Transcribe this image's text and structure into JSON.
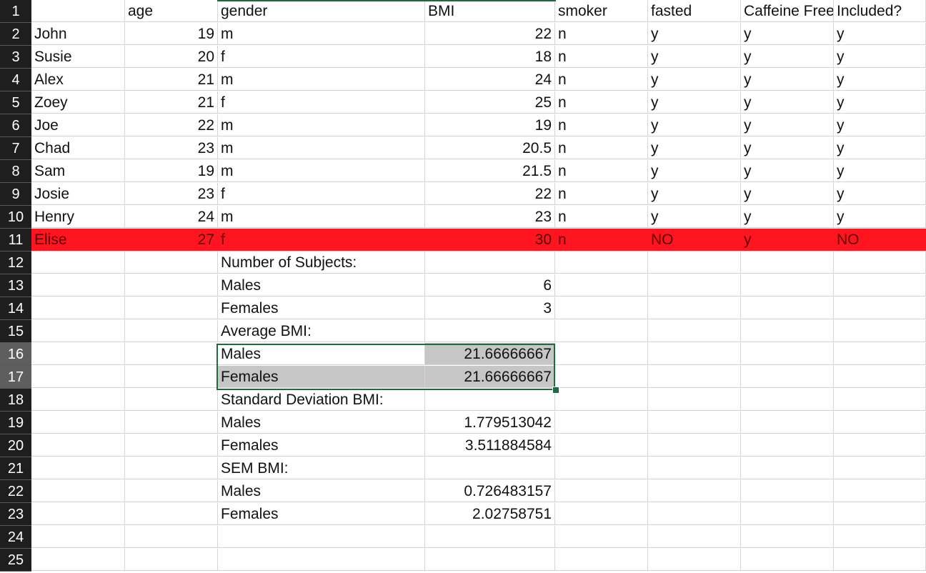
{
  "spreadsheet": {
    "columns": {
      "a": "",
      "b": "age",
      "c": "gender",
      "d": "BMI",
      "e": "smoker",
      "f": "fasted",
      "g": "Caffeine Free",
      "h": "Included?"
    },
    "subjects": [
      {
        "row": "2",
        "name": "John",
        "age": "19",
        "gender": "m",
        "bmi": "22",
        "smoker": "n",
        "fasted": "y",
        "caffeine": "y",
        "included": "y"
      },
      {
        "row": "3",
        "name": "Susie",
        "age": "20",
        "gender": "f",
        "bmi": "18",
        "smoker": "n",
        "fasted": "y",
        "caffeine": "y",
        "included": "y"
      },
      {
        "row": "4",
        "name": "Alex",
        "age": "21",
        "gender": "m",
        "bmi": "24",
        "smoker": "n",
        "fasted": "y",
        "caffeine": "y",
        "included": "y"
      },
      {
        "row": "5",
        "name": "Zoey",
        "age": "21",
        "gender": "f",
        "bmi": "25",
        "smoker": "n",
        "fasted": "y",
        "caffeine": "y",
        "included": "y"
      },
      {
        "row": "6",
        "name": "Joe",
        "age": "22",
        "gender": "m",
        "bmi": "19",
        "smoker": "n",
        "fasted": "y",
        "caffeine": "y",
        "included": "y"
      },
      {
        "row": "7",
        "name": "Chad",
        "age": "23",
        "gender": "m",
        "bmi": "20.5",
        "smoker": "n",
        "fasted": "y",
        "caffeine": "y",
        "included": "y"
      },
      {
        "row": "8",
        "name": "Sam",
        "age": "19",
        "gender": "m",
        "bmi": "21.5",
        "smoker": "n",
        "fasted": "y",
        "caffeine": "y",
        "included": "y"
      },
      {
        "row": "9",
        "name": "Josie",
        "age": "23",
        "gender": "f",
        "bmi": "22",
        "smoker": "n",
        "fasted": "y",
        "caffeine": "y",
        "included": "y"
      },
      {
        "row": "10",
        "name": "Henry",
        "age": "24",
        "gender": "m",
        "bmi": "23",
        "smoker": "n",
        "fasted": "y",
        "caffeine": "y",
        "included": "y"
      },
      {
        "row": "11",
        "name": "Elise",
        "age": "27",
        "gender": "f",
        "bmi": "30",
        "smoker": "n",
        "fasted": "NO",
        "caffeine": "y",
        "included": "NO",
        "highlighted": true
      }
    ],
    "summary": [
      {
        "row": "12",
        "label": "Number of Subjects:",
        "value": ""
      },
      {
        "row": "13",
        "label": "Males",
        "value": "6"
      },
      {
        "row": "14",
        "label": "Females",
        "value": "3"
      },
      {
        "row": "15",
        "label": "Average BMI:",
        "value": ""
      },
      {
        "row": "16",
        "label": "Males",
        "value": "21.66666667",
        "selected": true
      },
      {
        "row": "17",
        "label": "Females",
        "value": "21.66666667",
        "selected": true
      },
      {
        "row": "18",
        "label": "Standard Deviation BMI:",
        "value": ""
      },
      {
        "row": "19",
        "label": "Males",
        "value": "1.779513042"
      },
      {
        "row": "20",
        "label": "Females",
        "value": "3.511884584"
      },
      {
        "row": "21",
        "label": "SEM BMI:",
        "value": ""
      },
      {
        "row": "22",
        "label": "Males",
        "value": "0.726483157"
      },
      {
        "row": "23",
        "label": "Females",
        "value": "2.02758751"
      }
    ],
    "extra_rows": [
      "24",
      "25"
    ],
    "header_row_number": "1",
    "highlight_color": "#ff1520",
    "selection_color": "#1d6b3e",
    "selection_shade": "#c6c6c6"
  }
}
